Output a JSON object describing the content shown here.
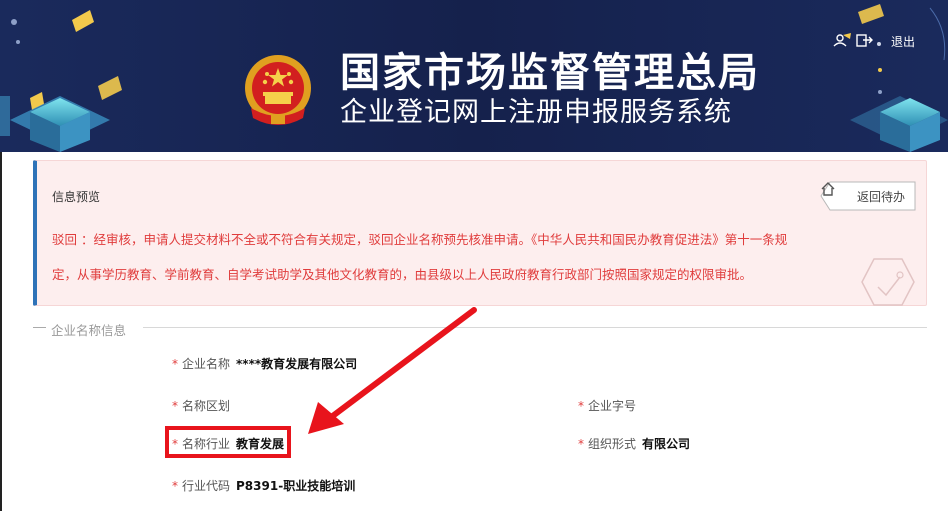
{
  "header": {
    "title_main": "国家市场监督管理总局",
    "title_sub": "企业登记网上注册申报服务系统",
    "logout_label": "退出",
    "colors": {
      "background": "#16234f",
      "accent_yellow": "#f2c94c",
      "accent_cyan": "#4fd0e0"
    }
  },
  "alert": {
    "title": "信息预览",
    "back_button_label": "返回待办",
    "reject_line1": "驳回 ：经审核，申请人提交材料不全或不符合有关规定，驳回企业名称预先核准申请。《中华人民共和国民办教育促进法》第十一条规",
    "reject_line2": "定，从事学历教育、学前教育、自学考试助学及其他文化教育的，由县级以上人民政府教育行政部门按照国家规定的权限审批。",
    "colors": {
      "text": "#e03c3c",
      "background": "#fdeeee",
      "border_accent": "#2e73b8"
    }
  },
  "section": {
    "title": "企业名称信息",
    "fields": {
      "company_name": {
        "required": "*",
        "label": "企业名称",
        "value": "****教育发展有限公司"
      },
      "name_region": {
        "required": "*",
        "label": "名称区划",
        "value": ""
      },
      "name_word": {
        "required": "*",
        "label": "企业字号",
        "value": ""
      },
      "name_industry": {
        "required": "*",
        "label": "名称行业",
        "value": "教育发展"
      },
      "org_form": {
        "required": "*",
        "label": "组织形式",
        "value": "有限公司"
      },
      "industry_code": {
        "required": "*",
        "label": "行业代码",
        "value": "P8391-职业技能培训"
      }
    }
  },
  "icons": {
    "emblem": "national-emblem-icon",
    "user": "user-icon",
    "logout": "logout-icon",
    "back": "home-icon"
  }
}
